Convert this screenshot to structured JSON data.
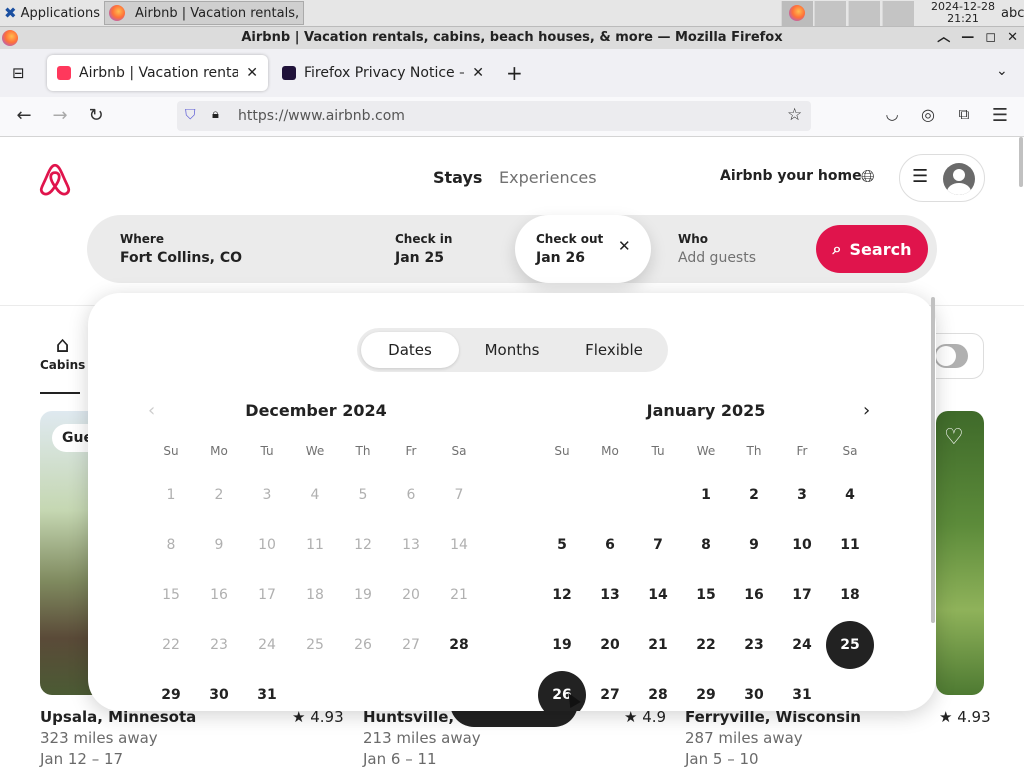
{
  "taskbar": {
    "apps_label": "Applications",
    "task_label": "Airbnb | Vacation rentals, ...",
    "clock_date": "2024-12-28",
    "clock_time": "21:21",
    "keyboard": "abc"
  },
  "window": {
    "title": "Airbnb | Vacation rentals, cabins, beach houses, & more — Mozilla Firefox"
  },
  "tabs": [
    {
      "label": "Airbnb | Vacation rentals, c",
      "active": true
    },
    {
      "label": "Firefox Privacy Notice — M",
      "active": false
    }
  ],
  "browser": {
    "url": "https://www.airbnb.com"
  },
  "header": {
    "stays": "Stays",
    "experiences": "Experiences",
    "host": "Airbnb your home"
  },
  "search": {
    "where_label": "Where",
    "where_value": "Fort Collins, CO",
    "checkin_label": "Check in",
    "checkin_value": "Jan 25",
    "checkout_label": "Check out",
    "checkout_value": "Jan 26",
    "who_label": "Who",
    "who_placeholder": "Add guests",
    "button_label": "Search"
  },
  "calendar": {
    "modes": [
      "Dates",
      "Months",
      "Flexible"
    ],
    "active_mode": "Dates",
    "weekdays": [
      "Su",
      "Mo",
      "Tu",
      "We",
      "Th",
      "Fr",
      "Sa"
    ],
    "months": [
      {
        "title": "December 2024",
        "first_weekday": 0,
        "days": 31,
        "past_until": 27
      },
      {
        "title": "January 2025",
        "first_weekday": 3,
        "days": 31,
        "past_until": 0
      }
    ],
    "selected": [
      {
        "month": 1,
        "day": 25
      },
      {
        "month": 1,
        "day": 26
      }
    ]
  },
  "categories": {
    "cabins": "Cabins"
  },
  "listings": [
    {
      "title": "Upsala, Minnesota",
      "rating": "4.93",
      "distance": "323 miles away",
      "dates": "Jan 12 – 17",
      "badge": "Gue"
    },
    {
      "title": "Huntsville, M",
      "rating": "4.9",
      "distance": "213 miles away",
      "dates": "Jan 6 – 11"
    },
    {
      "title": "Ferryville, Wisconsin",
      "rating": "4.93",
      "distance": "287 miles away",
      "dates": "Jan 5 – 10"
    }
  ],
  "colors": {
    "brand": "#e0144c",
    "selected_day": "#222222"
  }
}
